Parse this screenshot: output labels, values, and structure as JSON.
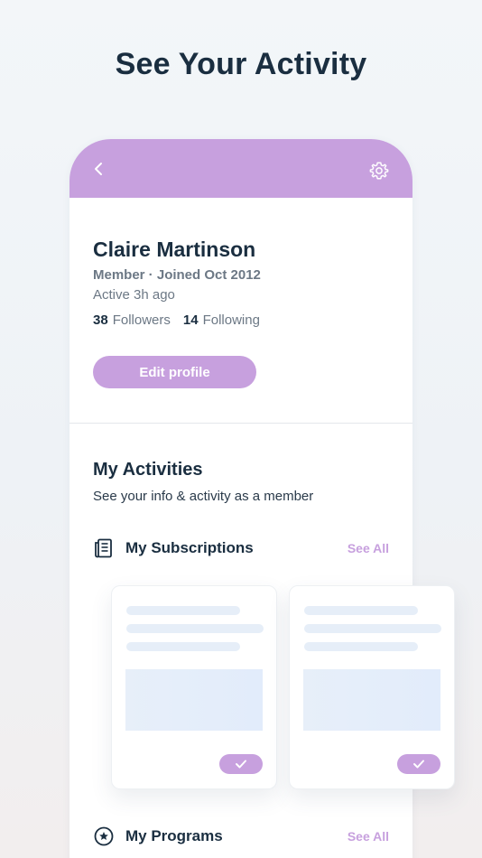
{
  "hero": {
    "title": "See Your Activity"
  },
  "header": {
    "back_icon": "chevron-left-icon",
    "settings_icon": "gear-icon",
    "accent": "#c7a0de"
  },
  "profile": {
    "name": "Claire Martinson",
    "membership": "Member · Joined Oct 2012",
    "active": "Active 3h ago",
    "followers_count": "38",
    "followers_label": "Followers",
    "following_count": "14",
    "following_label": "Following",
    "edit_label": "Edit profile"
  },
  "activities": {
    "title": "My Activities",
    "subtitle": "See your info & activity as a member",
    "sections": [
      {
        "label": "My Subscriptions",
        "icon": "newspaper-icon",
        "see_all": "See All"
      },
      {
        "label": "My Programs",
        "icon": "star-circle-icon",
        "see_all": "See All"
      }
    ]
  },
  "cards": [
    {
      "check_icon": "check-icon"
    },
    {
      "check_icon": "check-icon"
    }
  ]
}
